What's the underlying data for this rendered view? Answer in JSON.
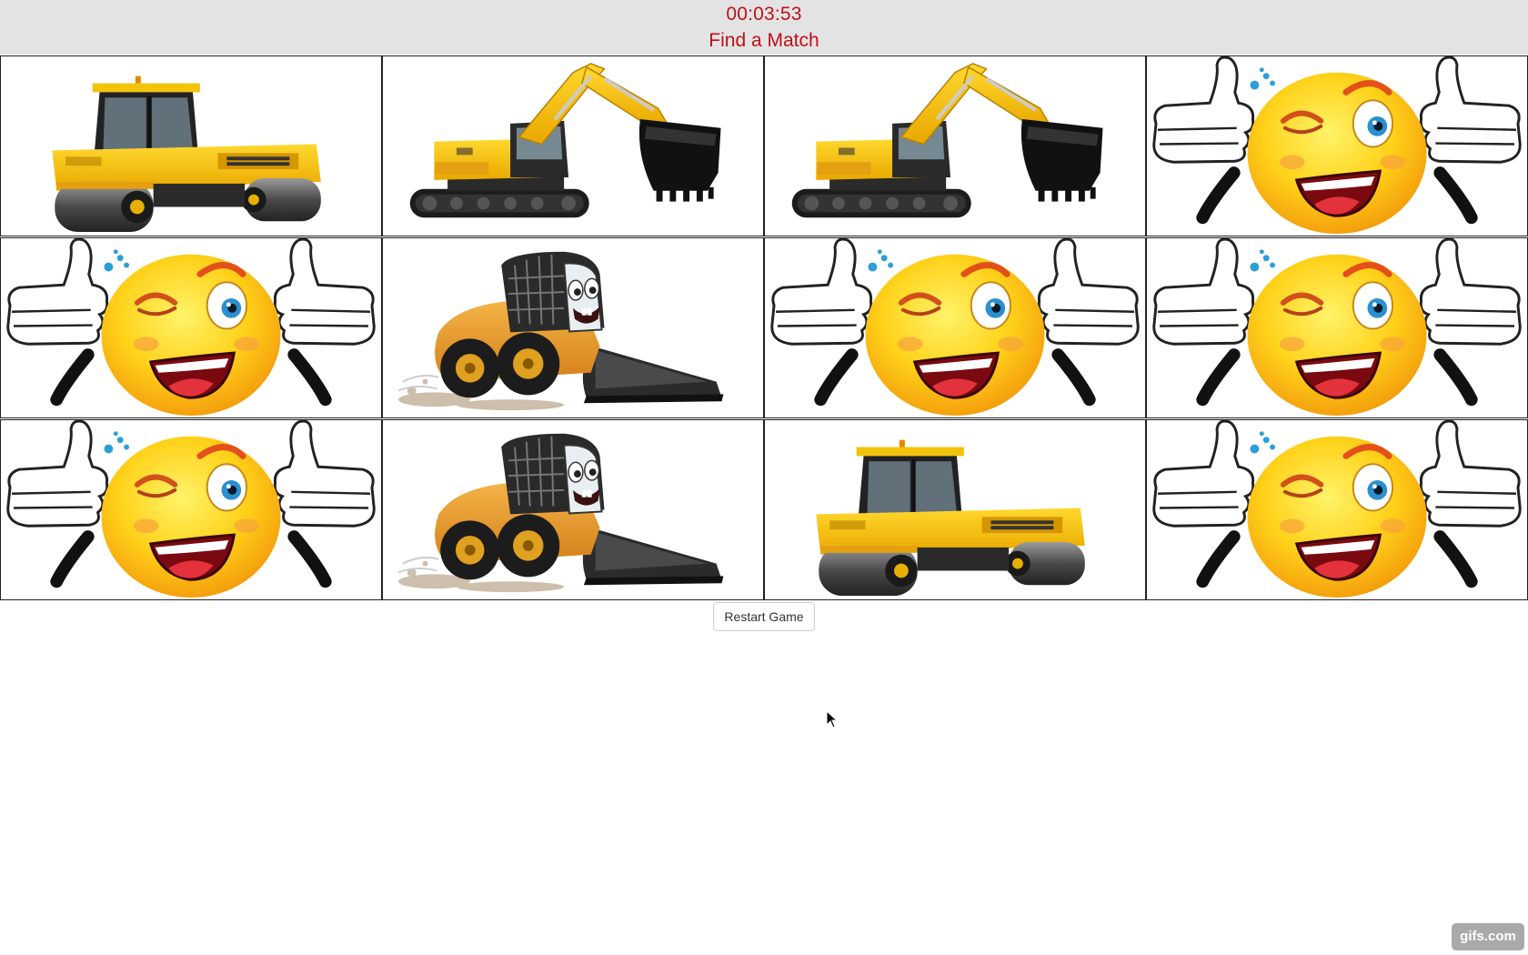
{
  "header": {
    "timer": "00:03:53",
    "subtitle": "Find a Match"
  },
  "board": {
    "rows": 3,
    "columns": 4,
    "cards": [
      {
        "image": "road-roller"
      },
      {
        "image": "excavator"
      },
      {
        "image": "excavator"
      },
      {
        "image": "winking-smiley-thumbs-up"
      },
      {
        "image": "winking-smiley-thumbs-up"
      },
      {
        "image": "cartoon-skid-steer-loader"
      },
      {
        "image": "winking-smiley-thumbs-up"
      },
      {
        "image": "winking-smiley-thumbs-up"
      },
      {
        "image": "winking-smiley-thumbs-up"
      },
      {
        "image": "cartoon-skid-steer-loader"
      },
      {
        "image": "road-roller"
      },
      {
        "image": "winking-smiley-thumbs-up"
      }
    ]
  },
  "controls": {
    "restart_label": "Restart Game"
  },
  "watermark": {
    "text": "gifs.com"
  },
  "colors": {
    "header_bg": "#e3e3e3",
    "header_text": "#c0101a",
    "card_border": "#222222"
  }
}
